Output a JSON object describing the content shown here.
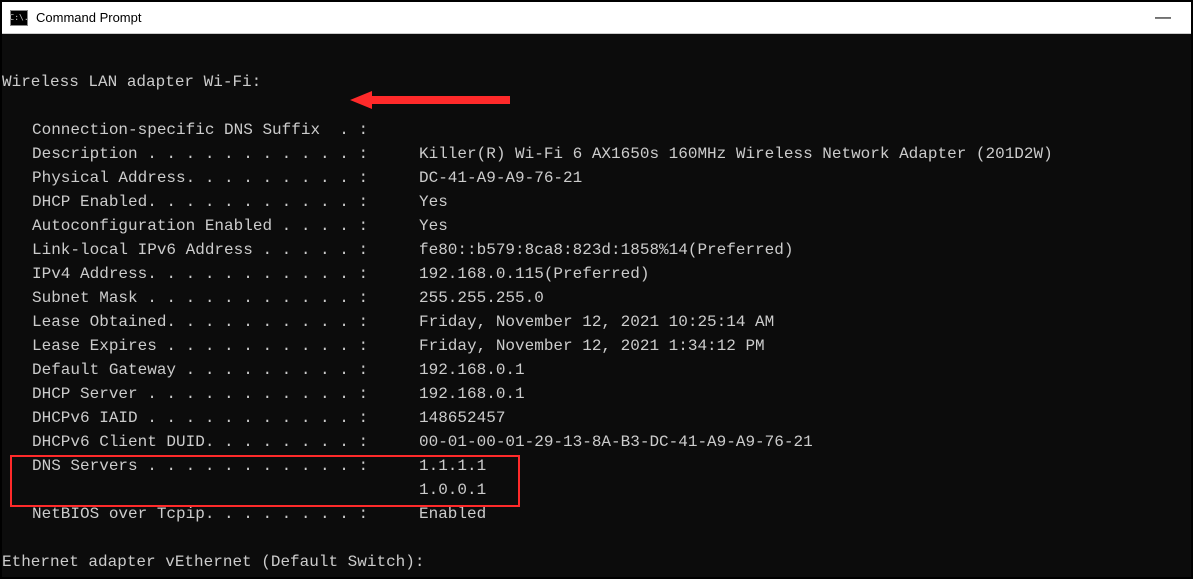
{
  "titlebar": {
    "icon_text": "C:\\.",
    "title": "Command Prompt",
    "minimize_label": "—"
  },
  "terminal": {
    "section_header": "Wireless LAN adapter Wi-Fi:",
    "rows": [
      {
        "label": "Connection-specific DNS Suffix  . :",
        "value": ""
      },
      {
        "label": "Description . . . . . . . . . . . :",
        "value": "Killer(R) Wi-Fi 6 AX1650s 160MHz Wireless Network Adapter (201D2W)"
      },
      {
        "label": "Physical Address. . . . . . . . . :",
        "value": "DC-41-A9-A9-76-21"
      },
      {
        "label": "DHCP Enabled. . . . . . . . . . . :",
        "value": "Yes"
      },
      {
        "label": "Autoconfiguration Enabled . . . . :",
        "value": "Yes"
      },
      {
        "label": "Link-local IPv6 Address . . . . . :",
        "value": "fe80::b579:8ca8:823d:1858%14(Preferred)"
      },
      {
        "label": "IPv4 Address. . . . . . . . . . . :",
        "value": "192.168.0.115(Preferred)"
      },
      {
        "label": "Subnet Mask . . . . . . . . . . . :",
        "value": "255.255.255.0"
      },
      {
        "label": "Lease Obtained. . . . . . . . . . :",
        "value": "Friday, November 12, 2021 10:25:14 AM"
      },
      {
        "label": "Lease Expires . . . . . . . . . . :",
        "value": "Friday, November 12, 2021 1:34:12 PM"
      },
      {
        "label": "Default Gateway . . . . . . . . . :",
        "value": "192.168.0.1"
      },
      {
        "label": "DHCP Server . . . . . . . . . . . :",
        "value": "192.168.0.1"
      },
      {
        "label": "DHCPv6 IAID . . . . . . . . . . . :",
        "value": "148652457"
      },
      {
        "label": "DHCPv6 Client DUID. . . . . . . . :",
        "value": "00-01-00-01-29-13-8A-B3-DC-41-A9-A9-76-21"
      },
      {
        "label": "DNS Servers . . . . . . . . . . . :",
        "value": "1.1.1.1"
      },
      {
        "label": "",
        "value": "1.0.0.1"
      },
      {
        "label": "NetBIOS over Tcpip. . . . . . . . :",
        "value": "Enabled"
      }
    ],
    "footer_section": "Ethernet adapter vEthernet (Default Switch):"
  },
  "annotations": {
    "arrow": "arrow-annotation",
    "dns_highlight": "dns-highlight-box"
  }
}
